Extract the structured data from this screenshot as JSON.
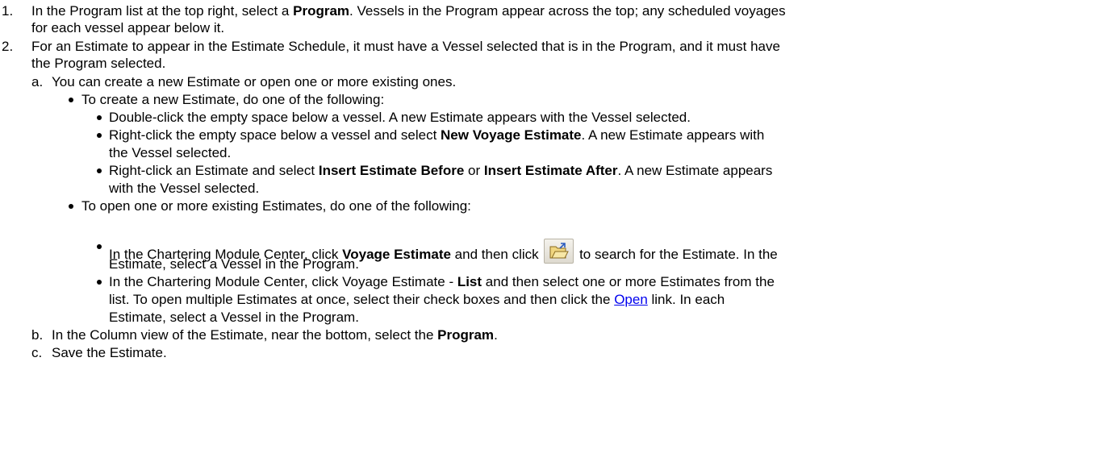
{
  "steps": {
    "step1": {
      "number": "1.",
      "line1_pre": "In the Program list at the top right, select a ",
      "line1_bold": "Program",
      "line1_post": ". Vessels in the Program appear across the top; any scheduled voyages",
      "line2": "for each vessel appear below it."
    },
    "step2": {
      "number": "2.",
      "line1": "For an Estimate to appear in the Estimate Schedule, it must have a Vessel selected that is in the Program, and it must have",
      "line2": "the Program selected."
    },
    "sub_a": {
      "letter": "a.",
      "text": "You can create a new Estimate or open one or more existing ones.",
      "create_intro": "To create a new Estimate, do one of the following:",
      "create_items": {
        "i1": "Double-click the empty space below a vessel. A new Estimate appears with the Vessel selected.",
        "i2_pre": "Right-click the empty space below a vessel and select ",
        "i2_bold": "New Voyage Estimate",
        "i2_post": ". A new Estimate appears with",
        "i2_line2": "the Vessel selected.",
        "i3_pre": "Right-click an Estimate and select ",
        "i3_bold1": "Insert Estimate Before",
        "i3_mid": " or ",
        "i3_bold2": "Insert Estimate After",
        "i3_post": ". A new Estimate appears",
        "i3_line2": "with the Vessel selected."
      },
      "open_intro": "To open one or more existing Estimates, do one of the following:",
      "open_items": {
        "i1_pre": "In the Chartering Module Center, click ",
        "i1_bold": "Voyage Estimate",
        "i1_mid": " and then click ",
        "i1_icon": "open-folder-icon",
        "i1_post": " to search for the Estimate. In the",
        "i1_line2": "Estimate, select a Vessel in the Program.",
        "i2_pre": "In the Chartering Module Center, click Voyage Estimate - ",
        "i2_bold": "List",
        "i2_post": " and then select one or more Estimates from the",
        "i2_line2_pre": "list. To open multiple Estimates at once, select their check boxes and then click the ",
        "i2_link": "Open",
        "i2_line2_post": " link. In each",
        "i2_line3": "Estimate, select a Vessel in the Program."
      }
    },
    "sub_b": {
      "letter": "b.",
      "pre": "In the Column view of the Estimate, near the bottom, select the ",
      "bold": "Program",
      "post": "."
    },
    "sub_c": {
      "letter": "c.",
      "text": "Save the Estimate."
    }
  }
}
